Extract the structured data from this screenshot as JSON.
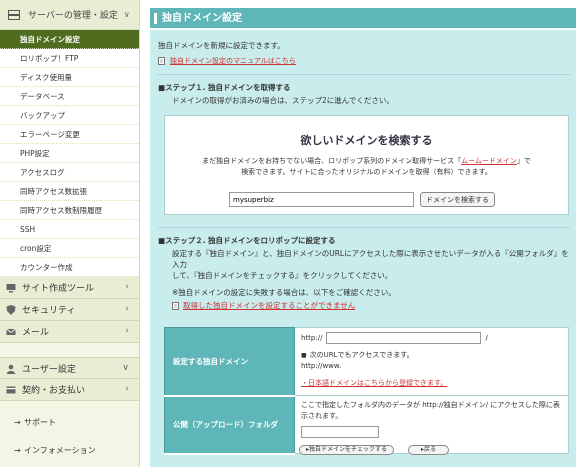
{
  "sidebar": {
    "server_section": {
      "label": "サーバーの管理・設定",
      "chevron": "∨",
      "icon": "server-icon"
    },
    "server_items": [
      {
        "label": "独自ドメイン設定",
        "active": true
      },
      {
        "label": "ロリポップ！FTP"
      },
      {
        "label": "ディスク使用量"
      },
      {
        "label": "データベース"
      },
      {
        "label": "バックアップ"
      },
      {
        "label": "エラーページ変更"
      },
      {
        "label": "PHP設定"
      }
    ],
    "access_items": [
      {
        "label": "アクセスログ"
      },
      {
        "label": "同時アクセス数拡張"
      },
      {
        "label": "同時アクセス数制限履歴"
      },
      {
        "label": "SSH"
      },
      {
        "label": "cron設定"
      },
      {
        "label": "カウンター作成"
      }
    ],
    "nav": [
      {
        "label": "サイト作成ツール",
        "icon": "monitor-icon",
        "chevron": "›"
      },
      {
        "label": "セキュリティ",
        "icon": "shield-icon",
        "chevron": "›"
      },
      {
        "label": "メール",
        "icon": "mail-icon",
        "chevron": "›"
      }
    ],
    "nav2": [
      {
        "label": "ユーザー設定",
        "icon": "user-icon",
        "chevron": "∨"
      },
      {
        "label": "契約・お支払い",
        "icon": "card-icon",
        "chevron": "›"
      }
    ],
    "links": [
      {
        "label": "サポート"
      },
      {
        "label": "インフォメーション"
      }
    ]
  },
  "main": {
    "title": "独自ドメイン設定",
    "description": "独自ドメインを新規に設定できます。",
    "manual_link": "独自ドメイン設定のマニュアルはこちら",
    "step1": {
      "title": "■ステップ１. 独自ドメインを取得する",
      "subtitle": "ドメインの取得がお済みの場合は、ステップ2に進んでください。"
    },
    "search": {
      "title": "欲しいドメインを検索する",
      "desc_prefix": "まだ独自ドメインをお持ちでない場合、ロリポップ系列のドメイン取得サービス「",
      "desc_link": "ムームードメイン",
      "desc_suffix": "」で",
      "desc_line2": "検索できます。サイトに合ったオリジナルのドメインを取得（有料）できます。",
      "input_value": "mysuperbiz",
      "button_label": "ドメインを検索する"
    },
    "step2": {
      "title": "■ステップ２. 独自ドメインをロリポップに設定する",
      "line1": "設定する『独自ドメイン』と、独自ドメインのURLにアクセスした際に表示させたいデータが入る『公開フォルダ』を入力",
      "line2": "して、『独自ドメインをチェックする』をクリックしてください。",
      "note": "※独自ドメインの設定に失敗する場合は、以下をご確認ください。",
      "warn_link": "取得した独自ドメインを設定することができません"
    },
    "table": {
      "row1_label": "設定する独自ドメイン",
      "url_prefix": "http://",
      "url_suffix": "/",
      "url_note": "次のURLでもアクセスできます。",
      "url_example": "http://www.",
      "jp_link": "・日本語ドメインはこちらから登録できます。",
      "row2_label": "公開（アップロード）フォルダ",
      "folder_desc": "ここで指定したフォルダ内のデータが http://独自ドメイン/ にアクセスした際に表示されます。"
    },
    "buttons": {
      "check": "▸独自ドメインをチェックする",
      "back": "▸戻る"
    }
  }
}
